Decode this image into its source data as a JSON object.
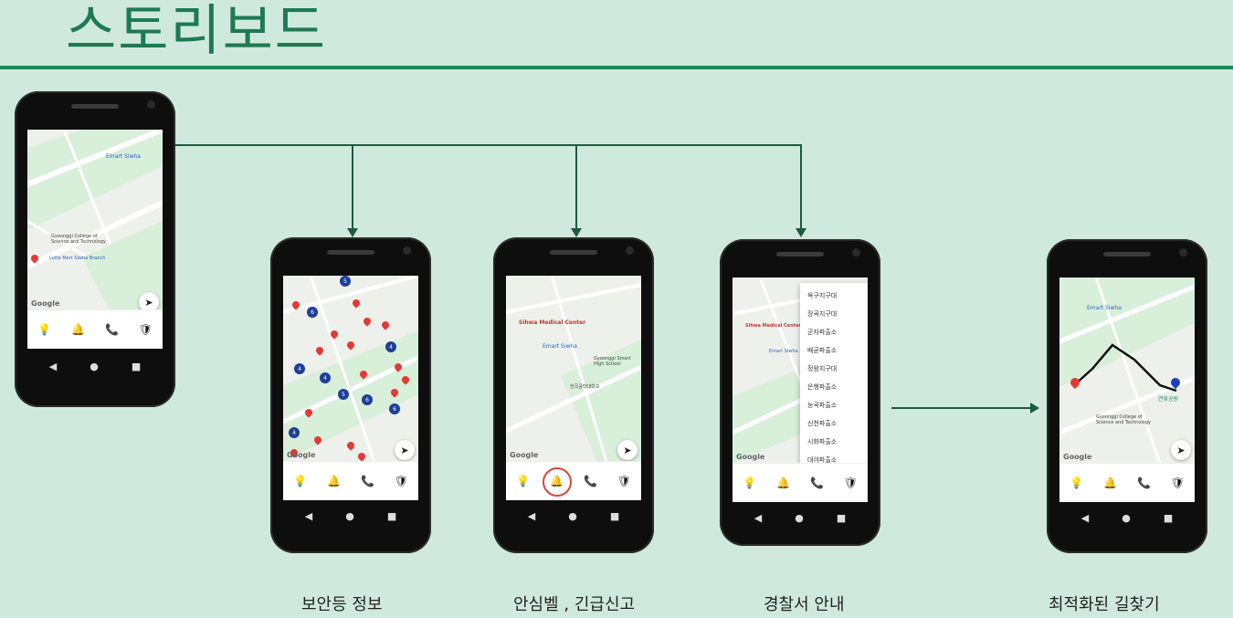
{
  "page": {
    "title": "스토리보드"
  },
  "captions": {
    "p2": "보안등 정보",
    "p3": "안심벨 , 긴급신고",
    "p4": "경찰서 안내",
    "p5": "최적화된 길찾기"
  },
  "map_labels": {
    "emart": "Emart Siwha",
    "college": "Gyeonggi College of Science and Technology",
    "lotte": "Lotte Mart Siwha Branch",
    "medical": "Sihwa Medical Center",
    "school": "Gyeonggi Smart High School",
    "park": "연꽃공원",
    "univ": "한국공학대학교",
    "google": "Google"
  },
  "police_menu": [
    "옥구지구대",
    "장곡지구대",
    "군자파출소",
    "배곧파출소",
    "정왕지구대",
    "은행파출소",
    "능곡파출소",
    "신천파출소",
    "시화파출소",
    "대야파출소"
  ],
  "nav_icons": {
    "bulb": "bulb-icon",
    "bell": "bell-icon",
    "phone": "phone-icon",
    "shield": "shield-icon"
  },
  "colors": {
    "accent": "#1a8a5a",
    "pin": "#e53935",
    "cluster": "#1e3f99",
    "ring": "#e0423a"
  }
}
